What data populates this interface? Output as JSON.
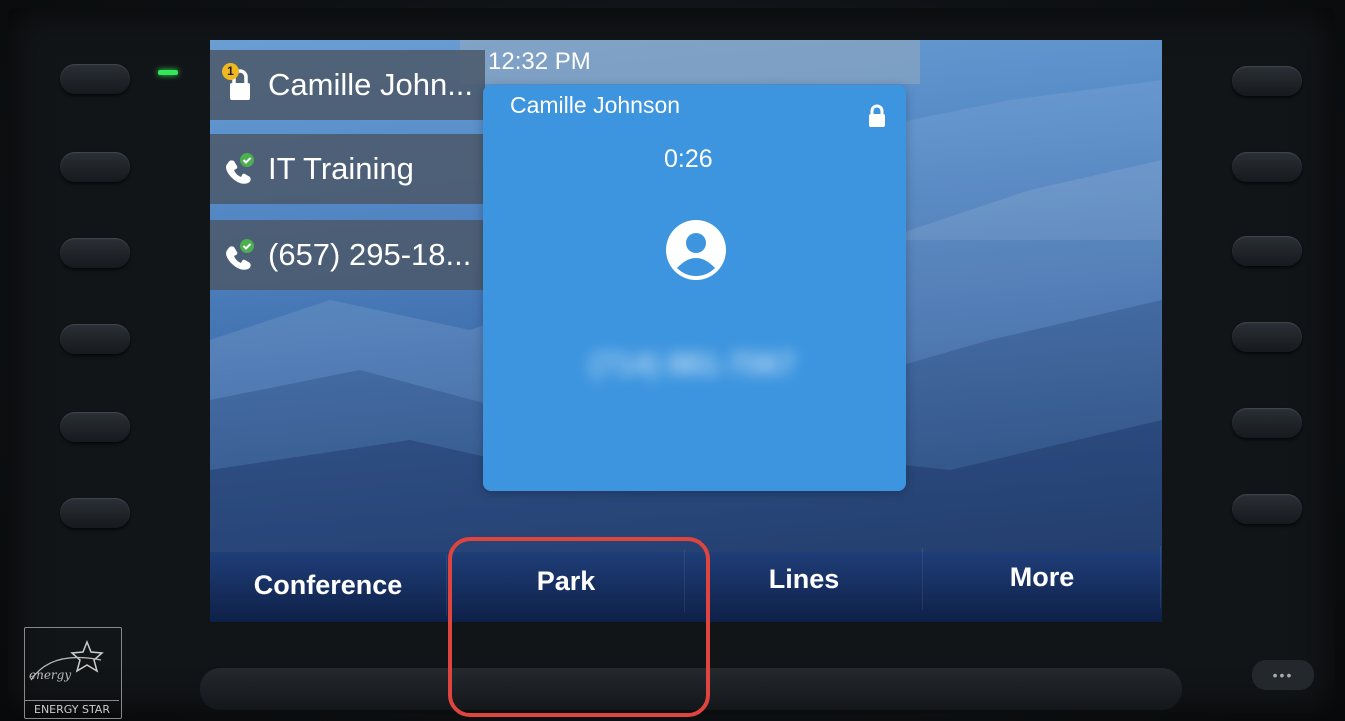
{
  "status_bar": {
    "time": "12:32 PM"
  },
  "lines": [
    {
      "label": "Camille John...",
      "icon": "lock-icon",
      "badge": "1",
      "status": "active"
    },
    {
      "label": "IT Training",
      "icon": "phone-check-icon",
      "status": "available"
    },
    {
      "label": "(657) 295-18...",
      "icon": "phone-check-icon",
      "status": "available"
    }
  ],
  "call": {
    "caller_name": "Camille Johnson",
    "duration": "0:26",
    "number_redacted": "(714) 881-7067",
    "icons": [
      "lock-icon",
      "avatar-icon"
    ]
  },
  "softkeys": [
    {
      "label": "Conference"
    },
    {
      "label": "Park",
      "highlighted": true
    },
    {
      "label": "Lines"
    },
    {
      "label": "More"
    }
  ],
  "hardware": {
    "more_button": "•••",
    "energy_star_label": "ENERGY STAR",
    "energy_star_script": "energy"
  },
  "colors": {
    "call_card": "#3d95df",
    "led": "#33e85a",
    "highlight": "#e0443e",
    "badge": "#f0b820"
  }
}
